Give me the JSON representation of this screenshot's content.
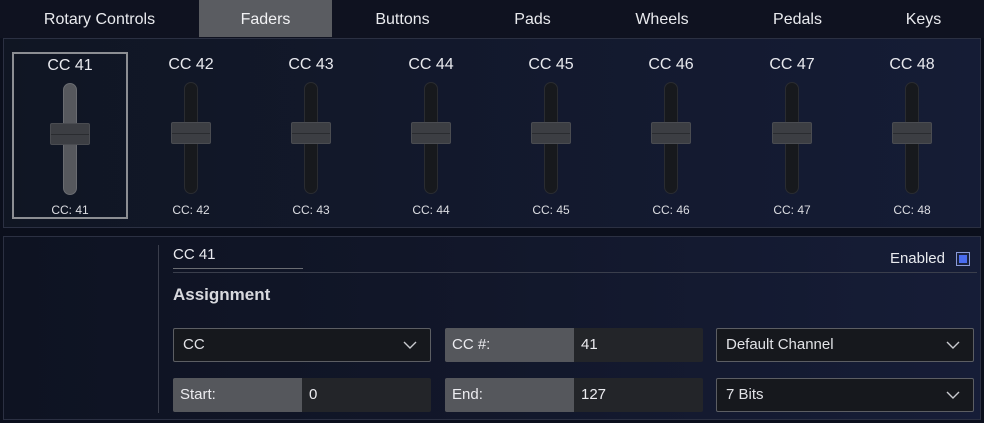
{
  "tabs": [
    {
      "label": "Rotary Controls",
      "active": false
    },
    {
      "label": "Faders",
      "active": true
    },
    {
      "label": "Buttons",
      "active": false
    },
    {
      "label": "Pads",
      "active": false
    },
    {
      "label": "Wheels",
      "active": false
    },
    {
      "label": "Pedals",
      "active": false
    },
    {
      "label": "Keys",
      "active": false
    }
  ],
  "faders": [
    {
      "title": "CC 41",
      "value": "CC: 41",
      "selected": true
    },
    {
      "title": "CC 42",
      "value": "CC: 42",
      "selected": false
    },
    {
      "title": "CC 43",
      "value": "CC: 43",
      "selected": false
    },
    {
      "title": "CC 44",
      "value": "CC: 44",
      "selected": false
    },
    {
      "title": "CC 45",
      "value": "CC: 45",
      "selected": false
    },
    {
      "title": "CC 46",
      "value": "CC: 46",
      "selected": false
    },
    {
      "title": "CC 47",
      "value": "CC: 47",
      "selected": false
    },
    {
      "title": "CC 48",
      "value": "CC: 48",
      "selected": false
    }
  ],
  "detail": {
    "name": "CC 41",
    "enabled_label": "Enabled",
    "enabled": true,
    "section_title": "Assignment",
    "type_select": "CC",
    "cc_label": "CC #:",
    "cc_value": "41",
    "channel_select": "Default Channel",
    "start_label": "Start:",
    "start_value": "0",
    "end_label": "End:",
    "end_value": "127",
    "bits_select": "7 Bits"
  },
  "colors": {
    "active_tab": "#5a5c61",
    "checkbox_accent": "#4a6cf0"
  }
}
